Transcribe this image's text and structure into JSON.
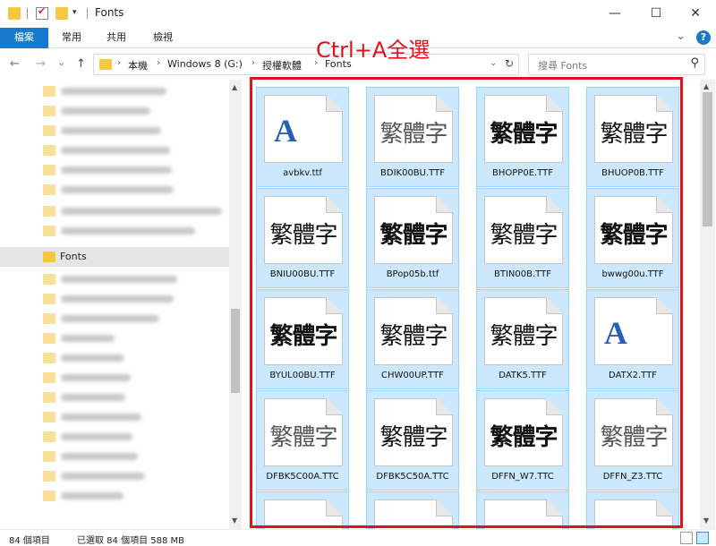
{
  "window": {
    "title": "Fonts",
    "minimize": "—",
    "maximize": "☐",
    "close": "✕"
  },
  "ribbon": {
    "tabs": [
      "檔案",
      "常用",
      "共用",
      "檢視"
    ],
    "expand": "⌄",
    "help": "?"
  },
  "address": {
    "back": "←",
    "forward": "→",
    "recent": "⌄",
    "up": "↑",
    "crumbs": [
      "本機",
      "Windows 8 (G:)",
      "授權軟體",
      "Fonts"
    ],
    "separator": "›",
    "dropdown": "⌄",
    "refresh": "↻"
  },
  "search": {
    "placeholder": "搜尋 Fonts",
    "icon": "⚲"
  },
  "navpane": {
    "selected": "Fonts",
    "up_arrow": "▲",
    "down_arrow": "▼"
  },
  "annotation": "Ctrl+A全選",
  "files": [
    {
      "name": "avbkv.ttf",
      "glyph": "A",
      "style": "latin"
    },
    {
      "name": "BDIK00BU.TTF",
      "glyph": "繁體字",
      "style": "light"
    },
    {
      "name": "BHOPP0E.TTF",
      "glyph": "繁體字",
      "style": "bold"
    },
    {
      "name": "BHUOP0B.TTF",
      "glyph": "繁體字",
      "style": "normal"
    },
    {
      "name": "BNIU00BU.TTF",
      "glyph": "繁體字",
      "style": "normal"
    },
    {
      "name": "BPop05b.ttf",
      "glyph": "繁體字",
      "style": "bold"
    },
    {
      "name": "BTIN00B.TTF",
      "glyph": "繁體字",
      "style": "normal"
    },
    {
      "name": "bwwg00u.TTF",
      "glyph": "繁體字",
      "style": "bold"
    },
    {
      "name": "BYUL00BU.TTF",
      "glyph": "繁體字",
      "style": "bold"
    },
    {
      "name": "CHW00UP.TTF",
      "glyph": "繁體字",
      "style": "normal"
    },
    {
      "name": "DATK5.TTF",
      "glyph": "繁體字",
      "style": "normal"
    },
    {
      "name": "DATX2.TTF",
      "glyph": "A",
      "style": "latin"
    },
    {
      "name": "DFBK5C00A.TTC",
      "glyph": "繁體字",
      "style": "light"
    },
    {
      "name": "DFBK5C50A.TTC",
      "glyph": "繁體字",
      "style": "normal"
    },
    {
      "name": "DFFN_W7.TTC",
      "glyph": "繁體字",
      "style": "bold"
    },
    {
      "name": "DFFN_Z3.TTC",
      "glyph": "繁體字",
      "style": "light"
    },
    {
      "name": "",
      "glyph": "",
      "style": "normal"
    },
    {
      "name": "",
      "glyph": "",
      "style": "normal"
    },
    {
      "name": "",
      "glyph": "",
      "style": "normal"
    },
    {
      "name": "",
      "glyph": "",
      "style": "normal"
    }
  ],
  "statusbar": {
    "count": "84 個項目",
    "selected": "已選取 84 個項目  588 MB"
  }
}
